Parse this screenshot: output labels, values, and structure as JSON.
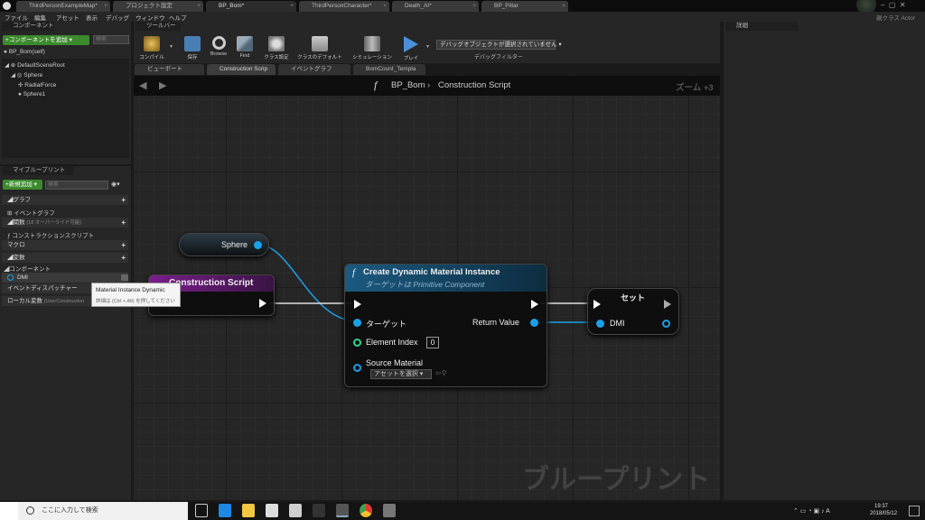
{
  "titlebar": {
    "tabs": [
      {
        "label": "ThirdPersonExampleMap*"
      },
      {
        "label": "プロジェクト設定"
      },
      {
        "label": "BP_Bom*"
      },
      {
        "label": "ThirdPersonCharacter*"
      },
      {
        "label": "Death_AI*"
      },
      {
        "label": "BP_Pillar"
      }
    ],
    "parent_class": "親クラス Actor"
  },
  "menu": {
    "items": [
      "ファイル",
      "編集",
      "アセット",
      "表示",
      "デバッグ",
      "ウィンドウ",
      "ヘルプ"
    ]
  },
  "components": {
    "header": "コンポーネント",
    "add_button": "+コンポーネントを追加 ▾",
    "search_placeholder": "検索",
    "self": "BP_Bom(self)",
    "tree": [
      "DefaultSceneRoot",
      "Sphere",
      "RadialForce",
      "Sphere1"
    ]
  },
  "toolbar": {
    "header": "ツールバー",
    "buttons": [
      {
        "label": "コンパイル"
      },
      {
        "label": "保存"
      },
      {
        "label": "Browse"
      },
      {
        "label": "Find"
      },
      {
        "label": "クラス設定"
      },
      {
        "label": "クラスのデフォルト"
      },
      {
        "label": "シミュレーション"
      },
      {
        "label": "プレイ"
      }
    ],
    "debug_select": "デバッグオブジェクトが選択されていません ▾",
    "debug_filter": "デバッグフィルター"
  },
  "graph_tabs": [
    "ビューポート",
    "Construction Scrip",
    "イベントグラフ",
    "BomCount_Templa"
  ],
  "breadcrumb": {
    "blueprint": "BP_Bom",
    "sep": "›",
    "graph": "Construction Script"
  },
  "zoom": "ズーム +3",
  "watermark": "ブループリント",
  "mybp": {
    "header": "マイブループリント",
    "add_button": "+新規追加 ▾",
    "search_placeholder": "検索",
    "graph_label": "グラフ",
    "event_graph": "イベントグラフ",
    "functions": "関数",
    "functions_sub": "(18 オーバーライド可能)",
    "construction": "コンストラクションスクリプト",
    "macros": "マクロ",
    "variables": "変数",
    "components": "コンポーネント",
    "dmi": "DMI",
    "dispatcher": "イベントディスパッチャー",
    "local_vars": "ローカル変数",
    "local_vars_sub": "(UserConstruction"
  },
  "tooltip": {
    "title": "Material Instance Dynamic",
    "hint": "詳細は (Ctrl + Alt) を押してください"
  },
  "details": {
    "header": "詳細"
  },
  "nodes": {
    "sphere": "Sphere",
    "construction": "Construction Script",
    "cdmi": {
      "title": "Create Dynamic Material Instance",
      "subtitle": "ターゲットは Primitive Component",
      "target": "ターゲット",
      "element_index": "Element Index",
      "element_value": "0",
      "source_material": "Source Material",
      "asset_select": "アセットを選択 ▾",
      "return_value": "Return Value"
    },
    "set": {
      "title": "セット",
      "dmi": "DMI"
    }
  },
  "taskbar": {
    "search": "ここに入力して検索",
    "time": "19:37",
    "date": "2018/05/12"
  },
  "colors": {
    "green": "#3c8a2e",
    "object_pin": "#1aa0e8",
    "int_pin": "#2fd18c",
    "construction_header": "#7a1e8c",
    "fn_header": "#1b5a80"
  }
}
